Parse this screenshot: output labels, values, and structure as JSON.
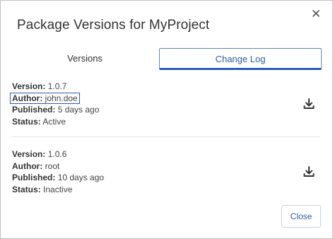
{
  "dialog": {
    "title": "Package Versions for MyProject",
    "close_button_label": "Close"
  },
  "tabs": [
    {
      "label": "Versions",
      "active": false
    },
    {
      "label": "Change Log",
      "active": true
    }
  ],
  "field_labels": {
    "version": "Version:",
    "author": "Author:",
    "published": "Published:",
    "status": "Status:"
  },
  "versions": [
    {
      "version": "1.0.7",
      "author": "john.doe",
      "published": "5 days ago",
      "status": "Active"
    },
    {
      "version": "1.0.6",
      "author": "root",
      "published": "10 days ago",
      "status": "Inactive"
    }
  ],
  "icons": {
    "close": "close-icon",
    "download": "download-icon"
  },
  "colors": {
    "accent": "#2a5db0",
    "text": "#333333",
    "border": "#bfbfbf"
  }
}
